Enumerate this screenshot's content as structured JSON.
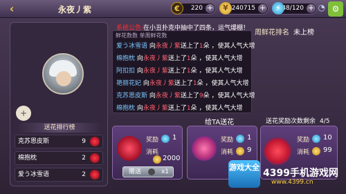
{
  "topbar": {
    "back_icon": "back-arrow-icon",
    "player_name": "永夜丿紫",
    "gold": "220",
    "coins": "240715",
    "energy": "148/120",
    "plus_label": "+",
    "menu_label": "设置"
  },
  "notice": {
    "red": "系统公告:",
    "text": "在小丑扑克中抽中了四条，运气爆棚！"
  },
  "log": {
    "header": "鲜花数数        单周鲜花数",
    "lines": [
      {
        "from": "爱う冰雪语",
        "mid": " 向",
        "to": "永夜丿紫",
        "rest1": "送上了",
        "num": "1",
        "rest2": "朵   ，使其人气大增"
      },
      {
        "from": "棉抱枕",
        "mid": " 向",
        "to": "永夜丿紫",
        "rest1": "送上了",
        "num": "1",
        "rest2": "朵   ，使其人气大增"
      },
      {
        "from": "阿扣扣",
        "mid": " 向",
        "to": "永夜丿紫",
        "rest1": "送上了",
        "num": "1",
        "rest2": "朵  ，使其人气大增"
      },
      {
        "from": "艳丽花妃",
        "mid": " 向",
        "to": "永夜丿紫",
        "rest1": "送上了",
        "num": "1",
        "rest2": "朵   ，使其人气大增"
      },
      {
        "from": "克苏恩皮斯",
        "mid": " 向",
        "to": "永夜丿紫",
        "rest1": "送上了",
        "num": "9",
        "rest2": "朵   ，使其人气大增"
      },
      {
        "from": "棉抱枕",
        "mid": " 向",
        "to": "永夜丿紫",
        "rest1": "送上了",
        "num": "1",
        "rest2": "朵   ，使其人气大增"
      }
    ]
  },
  "fresh_rank": {
    "label": "周鲜花排名",
    "value": "未上榜"
  },
  "left": {
    "rank_title": "送花排行榜",
    "add_icon": "add-friend-icon",
    "rows": [
      {
        "name": "克苏恩皮斯",
        "count": "9"
      },
      {
        "name": "棉抱枕",
        "count": "2"
      },
      {
        "name": "爱う冰雪语",
        "count": "2"
      }
    ]
  },
  "give": {
    "title": "给TA送花",
    "remaining_label": "送花奖励次数剩余",
    "remaining_value": "4/5"
  },
  "cards": [
    {
      "reward_label": "奖励",
      "reward": "1",
      "cost_label": "消耗",
      "cost": "2000",
      "send_label": "赠送",
      "send_count": "x1"
    },
    {
      "reward_label": "奖励",
      "reward": "1",
      "cost_label": "消耗",
      "cost": "9",
      "send_label": "",
      "send_count": ""
    },
    {
      "reward_label": "奖励",
      "reward": "10",
      "cost_label": "消耗",
      "cost": "99",
      "send_label": "",
      "send_count": ""
    }
  ],
  "watermark": {
    "logo": "游戏大全",
    "text": "4399手机游戏网",
    "url": "www.4399.cn"
  },
  "colors": {
    "accent": "#ff3030",
    "link": "#7cc6ff",
    "gold": "#f0c84a"
  }
}
